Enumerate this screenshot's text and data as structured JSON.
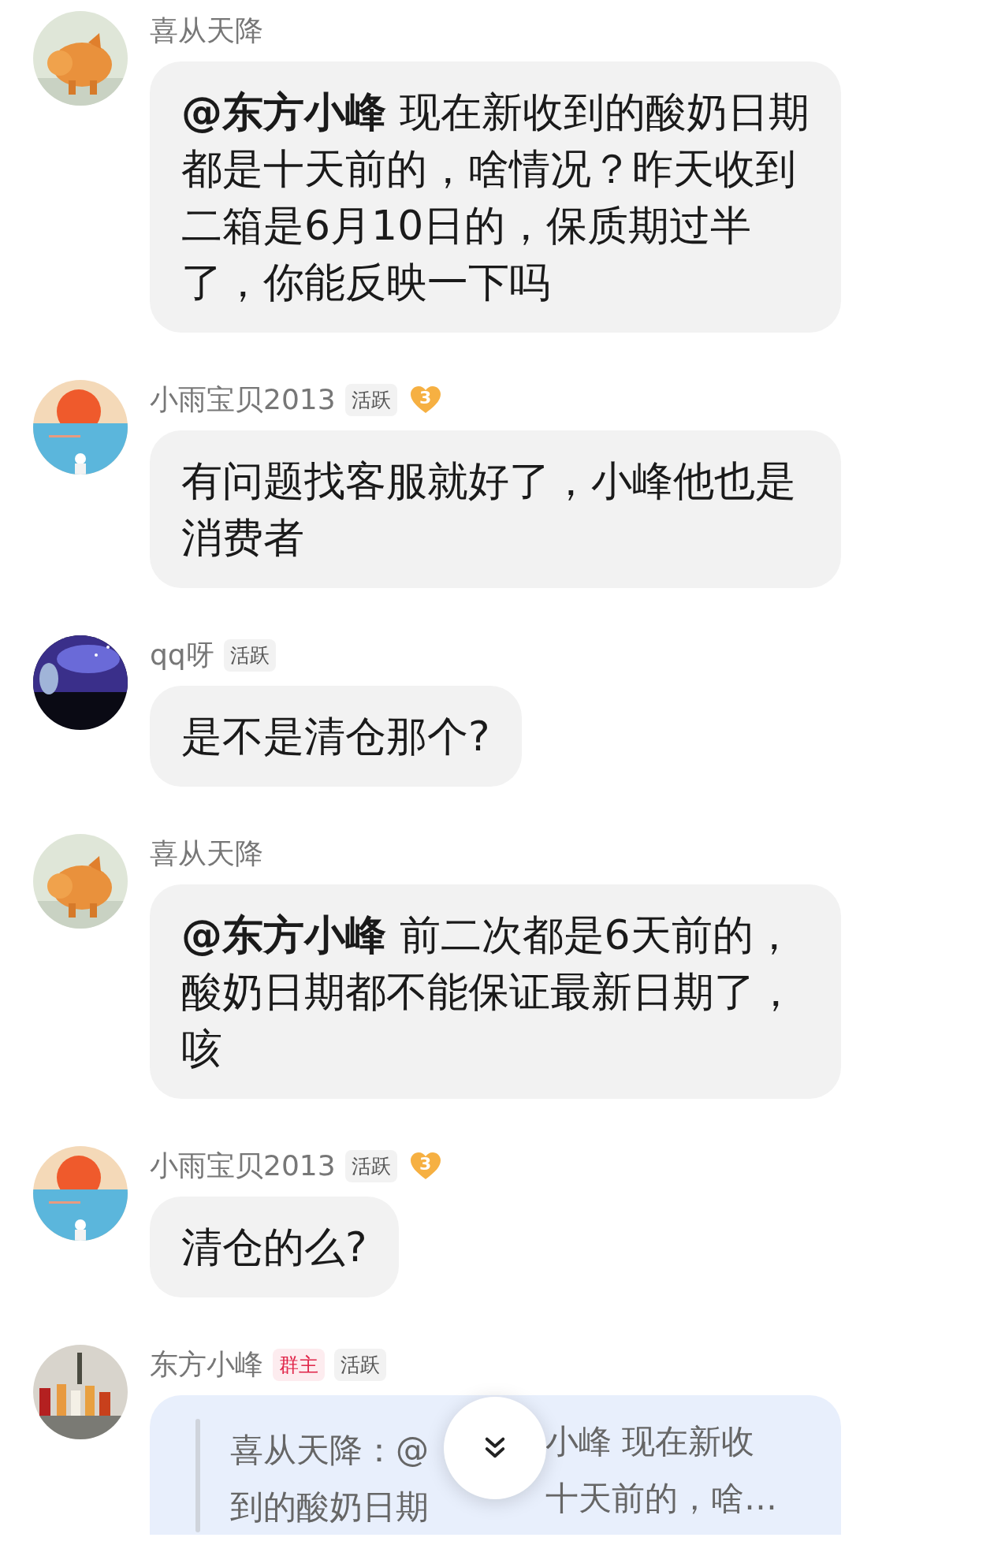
{
  "messages": [
    {
      "sender": "喜从天降",
      "text": "**@东方小峰** 现在新收到的酸奶日期都是十天前的，啥情况？昨天收到二箱是6月10日的，保质期过半了，你能反映一下吗"
    },
    {
      "sender": "小雨宝贝2013",
      "badges": [
        {
          "kind": "tag",
          "label": "活跃"
        },
        {
          "kind": "heart",
          "label": "3"
        }
      ],
      "text": "有问题找客服就好了，小峰他也是消费者"
    },
    {
      "sender": "qq呀",
      "badges": [
        {
          "kind": "tag",
          "label": "活跃"
        }
      ],
      "text": "是不是清仓那个?"
    },
    {
      "sender": "喜从天降",
      "text": "**@东方小峰** 前二次都是6天前的，酸奶日期都不能保证最新日期了，咳"
    },
    {
      "sender": "小雨宝贝2013",
      "badges": [
        {
          "kind": "tag",
          "label": "活跃"
        },
        {
          "kind": "heart",
          "label": "3"
        }
      ],
      "text": "清仓的么?"
    },
    {
      "sender": "东方小峰",
      "badges": [
        {
          "kind": "owner",
          "label": "群主"
        },
        {
          "kind": "tag",
          "label": "活跃"
        }
      ],
      "quote_lines": [
        [
          "喜从天降：@",
          "小峰 现在新收"
        ],
        [
          "到的酸奶日期",
          "十天前的，啥…"
        ]
      ]
    }
  ]
}
